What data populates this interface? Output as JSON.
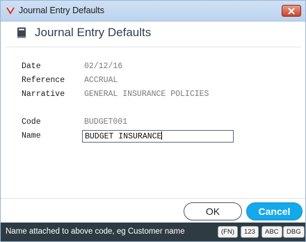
{
  "window": {
    "title": "Journal Entry Defaults",
    "close_icon": "close-icon",
    "app_icon": "app-logo-icon"
  },
  "header": {
    "title": "Journal Entry Defaults",
    "icon": "book-icon"
  },
  "fields": {
    "date": {
      "label": "Date",
      "value": "02/12/16"
    },
    "reference": {
      "label": "Reference",
      "value": "ACCRUAL"
    },
    "narrative": {
      "label": "Narrative",
      "value": "GENERAL INSURANCE POLICIES"
    },
    "code": {
      "label": "Code",
      "value": "BUDGET001"
    },
    "name": {
      "label": "Name",
      "value": "BUDGET INSURANCE"
    }
  },
  "buttons": {
    "ok_label": "OK",
    "cancel_label": "Cancel"
  },
  "status": {
    "text": "Name attached to above code, eg Customer name",
    "keys": [
      "(FN)",
      "123",
      "ABC",
      "DBG"
    ]
  },
  "colors": {
    "accent": "#15a8ea",
    "status_bar": "#2f3b43",
    "title_bar": "#c7dbf2"
  }
}
